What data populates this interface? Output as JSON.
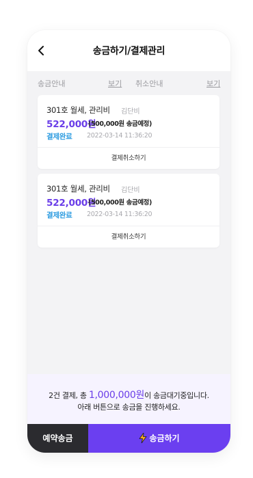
{
  "header": {
    "title": "송금하기/결제관리",
    "back_icon": "chevron-left-icon"
  },
  "guide_row": {
    "transfer_guide_label": "송금안내",
    "transfer_guide_link": "보기",
    "cancel_guide_label": "취소안내",
    "cancel_guide_link": "보기"
  },
  "payments": [
    {
      "name": "301호 월세, 관리비",
      "owner": "김단비",
      "amount": "522,000원",
      "scheduled": "(500,000원 송금예정)",
      "status": "결제완료",
      "date": "2022-03-14 11:36:20",
      "cancel_label": "결제취소하기"
    },
    {
      "name": "301호 월세, 관리비",
      "owner": "김단비",
      "amount": "522,000원",
      "scheduled": "(500,000원 송금예정)",
      "status": "결제완료",
      "date": "2022-03-14 11:36:20",
      "cancel_label": "결제취소하기"
    }
  ],
  "summary": {
    "prefix": "2건 결제, 총 ",
    "total": "1,000,000원",
    "suffix": "이 송금대기중입니다.",
    "line2": "아래 버튼으로 송금을 진행하세요."
  },
  "footer": {
    "reserve_label": "예약송금",
    "send_label": "송금하기",
    "send_icon": "lightning-bolt-icon"
  },
  "colors": {
    "accent": "#6b3ff0",
    "amount": "#6a3de8",
    "status": "#2b9be0",
    "dark_button": "#2b2b2f",
    "bolt": "#f5a623"
  }
}
